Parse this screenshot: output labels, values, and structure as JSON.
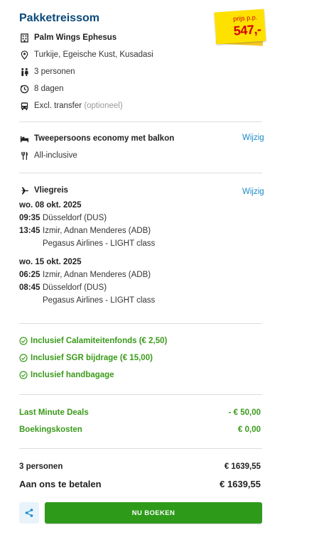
{
  "title": "Pakketreissom",
  "price": {
    "label": "prijs p.p.",
    "amount": "547,-"
  },
  "hotel": {
    "name": "Palm Wings Ephesus",
    "location": "Turkije, Egeische Kust, Kusadasi",
    "persons": "3 personen",
    "duration": "8 dagen",
    "transfer": "Excl. transfer",
    "transfer_note": "(optioneel)"
  },
  "room": {
    "type": "Tweepersoons economy met balkon",
    "board": "All-inclusive",
    "edit_label": "Wijzig"
  },
  "flight": {
    "heading": "Vliegreis",
    "edit_label": "Wijzig",
    "outbound": {
      "date": "wo. 08 okt. 2025",
      "dep_time": "09:35",
      "dep_airport": "Düsseldorf (DUS)",
      "arr_time": "13:45",
      "arr_airport": "Izmir, Adnan Menderes (ADB)",
      "carrier": "Pegasus Airlines - LIGHT class"
    },
    "return": {
      "date": "wo. 15 okt. 2025",
      "dep_time": "06:25",
      "dep_airport": "Izmir, Adnan Menderes (ADB)",
      "arr_time": "08:45",
      "arr_airport": "Düsseldorf (DUS)",
      "carrier": "Pegasus Airlines - LIGHT class"
    }
  },
  "inclusions": [
    "Inclusief Calamiteitenfonds (€ 2,50)",
    "Inclusief SGR bijdrage (€ 15,00)",
    "Inclusief handbagage"
  ],
  "costs": [
    {
      "label": "Last Minute Deals",
      "value": "- € 50,00"
    },
    {
      "label": "Boekingskosten",
      "value": "€ 0,00"
    }
  ],
  "totals": {
    "persons_label": "3 personen",
    "persons_value": "€ 1639,55",
    "pay_label": "Aan ons te betalen",
    "pay_value": "€ 1639,55"
  },
  "actions": {
    "book_label": "NU BOEKEN"
  },
  "colors": {
    "brand": "#0a4a7a",
    "link": "#1a8bc8",
    "green": "#2e9a1a",
    "price": "#d40000",
    "tag": "#ffe100"
  }
}
